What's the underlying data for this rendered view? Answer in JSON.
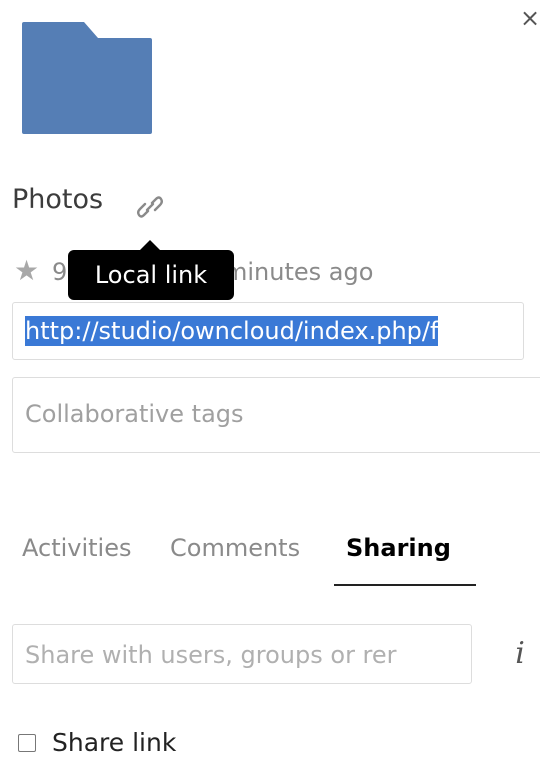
{
  "file": {
    "name": "Photos",
    "size": "9",
    "modified": "minutes ago"
  },
  "tooltip": {
    "text": "Local link"
  },
  "url_field": {
    "value": "http://studio/owncloud/index.php/f"
  },
  "tags_field": {
    "placeholder": "Collaborative tags"
  },
  "tabs": [
    {
      "label": "Activities"
    },
    {
      "label": "Comments"
    },
    {
      "label": "Sharing"
    }
  ],
  "share": {
    "placeholder": "Share with users, groups or rer",
    "share_link_label": "Share link"
  },
  "icons": {
    "close": "close-icon",
    "folder": "folder-icon",
    "link": "link-icon",
    "star": "star-icon",
    "info": "info-icon"
  },
  "colors": {
    "folder": "#557eb5",
    "selection": "#3a79d6",
    "tooltip_bg": "#000000"
  }
}
